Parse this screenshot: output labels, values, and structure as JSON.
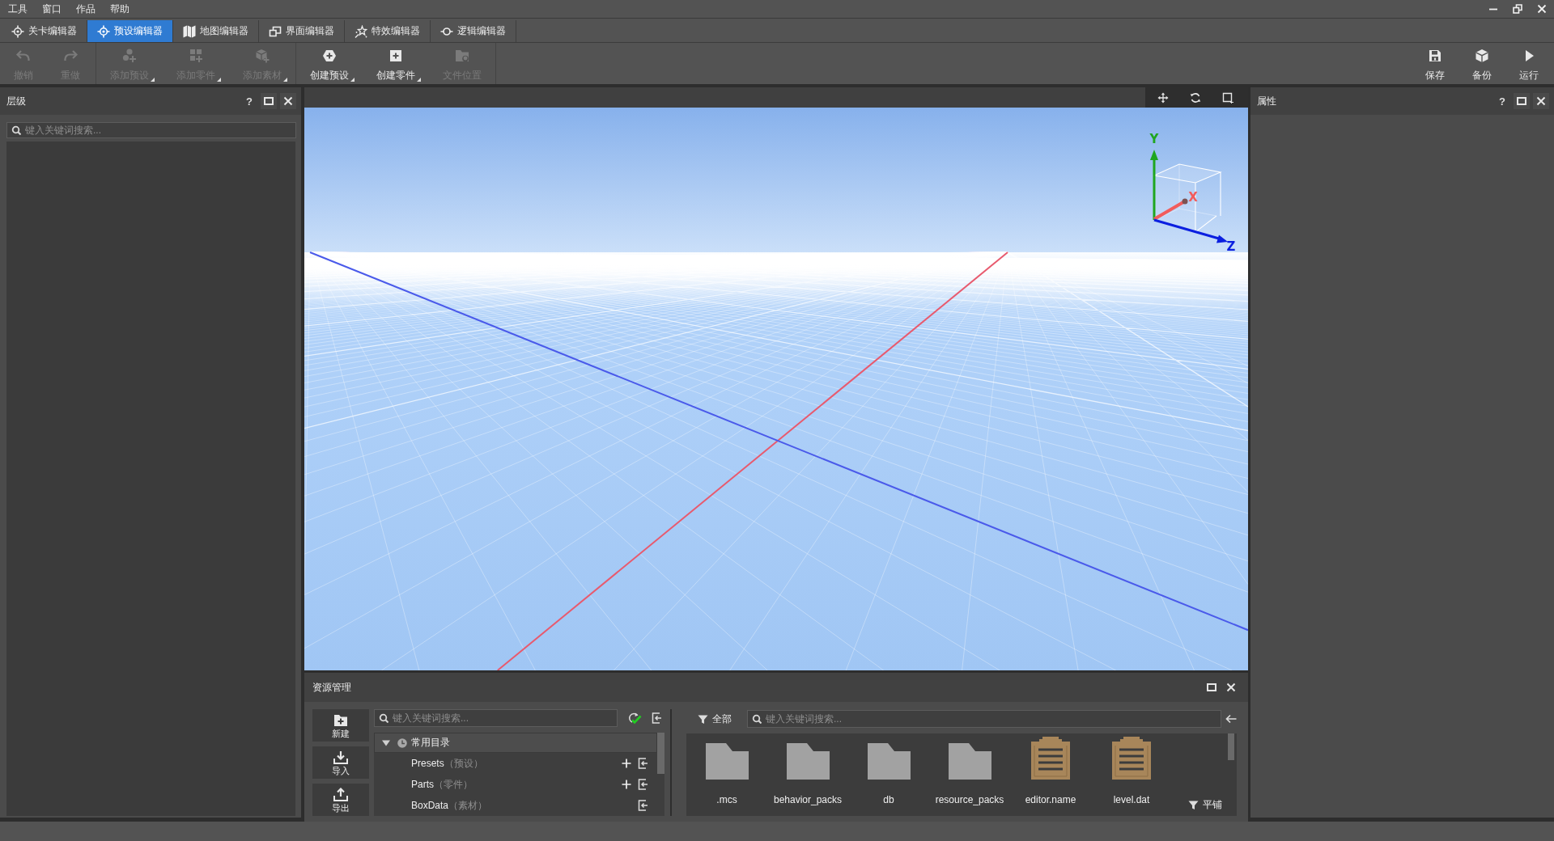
{
  "menu_bar": {
    "items": [
      "工具",
      "窗口",
      "作品",
      "帮助"
    ]
  },
  "tabs": [
    {
      "label": "关卡编辑器",
      "selected": false
    },
    {
      "label": "预设编辑器",
      "selected": true
    },
    {
      "label": "地图编辑器",
      "selected": false
    },
    {
      "label": "界面编辑器",
      "selected": false
    },
    {
      "label": "特效编辑器",
      "selected": false
    },
    {
      "label": "逻辑编辑器",
      "selected": false
    }
  ],
  "toolbar": {
    "groups": [
      [
        {
          "label": "撤销",
          "disabled": true,
          "has_menu": false
        },
        {
          "label": "重做",
          "disabled": true,
          "has_menu": false
        }
      ],
      [
        {
          "label": "添加预设",
          "disabled": true,
          "has_menu": true
        },
        {
          "label": "添加零件",
          "disabled": true,
          "has_menu": true
        },
        {
          "label": "添加素材",
          "disabled": true,
          "has_menu": true
        }
      ],
      [
        {
          "label": "创建预设",
          "disabled": false,
          "has_menu": true
        },
        {
          "label": "创建零件",
          "disabled": false,
          "has_menu": true
        },
        {
          "label": "文件位置",
          "disabled": true,
          "has_menu": false
        }
      ]
    ],
    "right": [
      {
        "label": "保存",
        "disabled": false
      },
      {
        "label": "备份",
        "disabled": false
      },
      {
        "label": "运行",
        "disabled": false
      }
    ]
  },
  "hierarchy_panel": {
    "title": "层级",
    "help": "?",
    "search": {
      "placeholder": "键入关键词搜索..."
    }
  },
  "viewport": {
    "gizmo": {
      "axes": [
        {
          "label": "Y",
          "color": "#1fa61f"
        },
        {
          "label": "X",
          "color": "#f25c5c"
        },
        {
          "label": "Z",
          "color": "#0b1fe0"
        }
      ]
    }
  },
  "properties_panel": {
    "title": "属性",
    "help": "?"
  },
  "asset_panel": {
    "title": "资源管理",
    "actions": [
      "新建",
      "导入",
      "导出"
    ],
    "tree": {
      "search": {
        "placeholder": "键入关键词搜索..."
      },
      "items": [
        {
          "label": "常用目录",
          "expanded": true,
          "children": [
            {
              "name": "Presets",
              "note": "（预设）",
              "can_add": true
            },
            {
              "name": "Parts",
              "note": "（零件）",
              "can_add": true
            },
            {
              "name": "BoxData",
              "note": "（素材）",
              "can_add": false
            }
          ]
        }
      ]
    },
    "browser": {
      "filter": "全部",
      "search": {
        "placeholder": "键入关键词搜索..."
      },
      "files": [
        {
          "name": ".mcs",
          "kind": "folder"
        },
        {
          "name": "behavior_packs",
          "kind": "folder"
        },
        {
          "name": "db",
          "kind": "folder"
        },
        {
          "name": "resource_packs",
          "kind": "folder"
        },
        {
          "name": "editor.name",
          "kind": "file"
        },
        {
          "name": "level.dat",
          "kind": "file"
        }
      ],
      "view_mode": "平铺"
    }
  }
}
